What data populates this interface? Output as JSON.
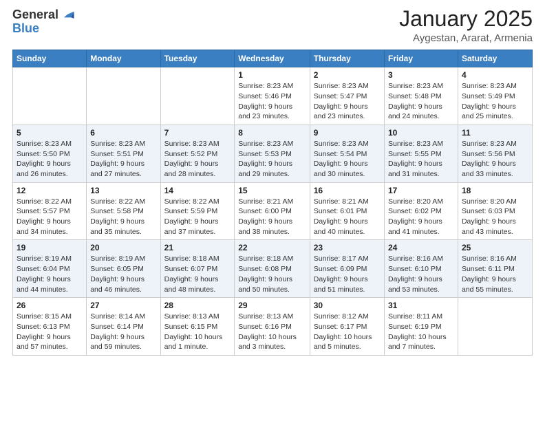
{
  "logo": {
    "general": "General",
    "blue": "Blue"
  },
  "header": {
    "month": "January 2025",
    "location": "Aygestan, Ararat, Armenia"
  },
  "weekdays": [
    "Sunday",
    "Monday",
    "Tuesday",
    "Wednesday",
    "Thursday",
    "Friday",
    "Saturday"
  ],
  "weeks": [
    [
      {
        "day": "",
        "sunrise": "",
        "sunset": "",
        "daylight": ""
      },
      {
        "day": "",
        "sunrise": "",
        "sunset": "",
        "daylight": ""
      },
      {
        "day": "",
        "sunrise": "",
        "sunset": "",
        "daylight": ""
      },
      {
        "day": "1",
        "sunrise": "Sunrise: 8:23 AM",
        "sunset": "Sunset: 5:46 PM",
        "daylight": "Daylight: 9 hours and 23 minutes."
      },
      {
        "day": "2",
        "sunrise": "Sunrise: 8:23 AM",
        "sunset": "Sunset: 5:47 PM",
        "daylight": "Daylight: 9 hours and 23 minutes."
      },
      {
        "day": "3",
        "sunrise": "Sunrise: 8:23 AM",
        "sunset": "Sunset: 5:48 PM",
        "daylight": "Daylight: 9 hours and 24 minutes."
      },
      {
        "day": "4",
        "sunrise": "Sunrise: 8:23 AM",
        "sunset": "Sunset: 5:49 PM",
        "daylight": "Daylight: 9 hours and 25 minutes."
      }
    ],
    [
      {
        "day": "5",
        "sunrise": "Sunrise: 8:23 AM",
        "sunset": "Sunset: 5:50 PM",
        "daylight": "Daylight: 9 hours and 26 minutes."
      },
      {
        "day": "6",
        "sunrise": "Sunrise: 8:23 AM",
        "sunset": "Sunset: 5:51 PM",
        "daylight": "Daylight: 9 hours and 27 minutes."
      },
      {
        "day": "7",
        "sunrise": "Sunrise: 8:23 AM",
        "sunset": "Sunset: 5:52 PM",
        "daylight": "Daylight: 9 hours and 28 minutes."
      },
      {
        "day": "8",
        "sunrise": "Sunrise: 8:23 AM",
        "sunset": "Sunset: 5:53 PM",
        "daylight": "Daylight: 9 hours and 29 minutes."
      },
      {
        "day": "9",
        "sunrise": "Sunrise: 8:23 AM",
        "sunset": "Sunset: 5:54 PM",
        "daylight": "Daylight: 9 hours and 30 minutes."
      },
      {
        "day": "10",
        "sunrise": "Sunrise: 8:23 AM",
        "sunset": "Sunset: 5:55 PM",
        "daylight": "Daylight: 9 hours and 31 minutes."
      },
      {
        "day": "11",
        "sunrise": "Sunrise: 8:23 AM",
        "sunset": "Sunset: 5:56 PM",
        "daylight": "Daylight: 9 hours and 33 minutes."
      }
    ],
    [
      {
        "day": "12",
        "sunrise": "Sunrise: 8:22 AM",
        "sunset": "Sunset: 5:57 PM",
        "daylight": "Daylight: 9 hours and 34 minutes."
      },
      {
        "day": "13",
        "sunrise": "Sunrise: 8:22 AM",
        "sunset": "Sunset: 5:58 PM",
        "daylight": "Daylight: 9 hours and 35 minutes."
      },
      {
        "day": "14",
        "sunrise": "Sunrise: 8:22 AM",
        "sunset": "Sunset: 5:59 PM",
        "daylight": "Daylight: 9 hours and 37 minutes."
      },
      {
        "day": "15",
        "sunrise": "Sunrise: 8:21 AM",
        "sunset": "Sunset: 6:00 PM",
        "daylight": "Daylight: 9 hours and 38 minutes."
      },
      {
        "day": "16",
        "sunrise": "Sunrise: 8:21 AM",
        "sunset": "Sunset: 6:01 PM",
        "daylight": "Daylight: 9 hours and 40 minutes."
      },
      {
        "day": "17",
        "sunrise": "Sunrise: 8:20 AM",
        "sunset": "Sunset: 6:02 PM",
        "daylight": "Daylight: 9 hours and 41 minutes."
      },
      {
        "day": "18",
        "sunrise": "Sunrise: 8:20 AM",
        "sunset": "Sunset: 6:03 PM",
        "daylight": "Daylight: 9 hours and 43 minutes."
      }
    ],
    [
      {
        "day": "19",
        "sunrise": "Sunrise: 8:19 AM",
        "sunset": "Sunset: 6:04 PM",
        "daylight": "Daylight: 9 hours and 44 minutes."
      },
      {
        "day": "20",
        "sunrise": "Sunrise: 8:19 AM",
        "sunset": "Sunset: 6:05 PM",
        "daylight": "Daylight: 9 hours and 46 minutes."
      },
      {
        "day": "21",
        "sunrise": "Sunrise: 8:18 AM",
        "sunset": "Sunset: 6:07 PM",
        "daylight": "Daylight: 9 hours and 48 minutes."
      },
      {
        "day": "22",
        "sunrise": "Sunrise: 8:18 AM",
        "sunset": "Sunset: 6:08 PM",
        "daylight": "Daylight: 9 hours and 50 minutes."
      },
      {
        "day": "23",
        "sunrise": "Sunrise: 8:17 AM",
        "sunset": "Sunset: 6:09 PM",
        "daylight": "Daylight: 9 hours and 51 minutes."
      },
      {
        "day": "24",
        "sunrise": "Sunrise: 8:16 AM",
        "sunset": "Sunset: 6:10 PM",
        "daylight": "Daylight: 9 hours and 53 minutes."
      },
      {
        "day": "25",
        "sunrise": "Sunrise: 8:16 AM",
        "sunset": "Sunset: 6:11 PM",
        "daylight": "Daylight: 9 hours and 55 minutes."
      }
    ],
    [
      {
        "day": "26",
        "sunrise": "Sunrise: 8:15 AM",
        "sunset": "Sunset: 6:13 PM",
        "daylight": "Daylight: 9 hours and 57 minutes."
      },
      {
        "day": "27",
        "sunrise": "Sunrise: 8:14 AM",
        "sunset": "Sunset: 6:14 PM",
        "daylight": "Daylight: 9 hours and 59 minutes."
      },
      {
        "day": "28",
        "sunrise": "Sunrise: 8:13 AM",
        "sunset": "Sunset: 6:15 PM",
        "daylight": "Daylight: 10 hours and 1 minute."
      },
      {
        "day": "29",
        "sunrise": "Sunrise: 8:13 AM",
        "sunset": "Sunset: 6:16 PM",
        "daylight": "Daylight: 10 hours and 3 minutes."
      },
      {
        "day": "30",
        "sunrise": "Sunrise: 8:12 AM",
        "sunset": "Sunset: 6:17 PM",
        "daylight": "Daylight: 10 hours and 5 minutes."
      },
      {
        "day": "31",
        "sunrise": "Sunrise: 8:11 AM",
        "sunset": "Sunset: 6:19 PM",
        "daylight": "Daylight: 10 hours and 7 minutes."
      },
      {
        "day": "",
        "sunrise": "",
        "sunset": "",
        "daylight": ""
      }
    ]
  ]
}
